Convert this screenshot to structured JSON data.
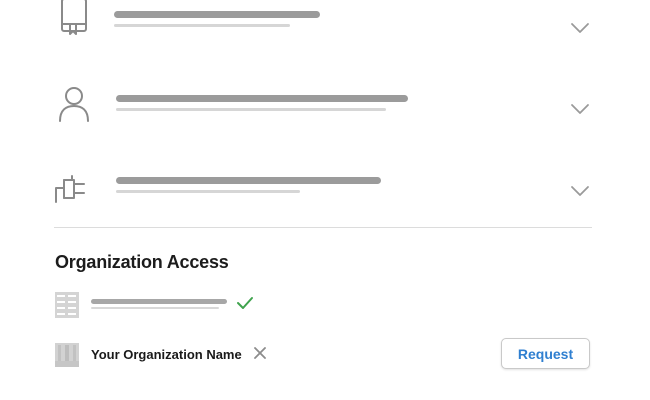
{
  "rows": [
    {
      "icon": "book-icon"
    },
    {
      "icon": "user-icon"
    },
    {
      "icon": "plug-icon"
    }
  ],
  "organization_access": {
    "title": "Organization Access",
    "organizations": [
      {
        "icon": "organization-building-icon",
        "status": "check-icon"
      },
      {
        "icon": "organization-building-icon",
        "name": "Your Organization Name",
        "status": "x-icon",
        "action_label": "Request"
      }
    ]
  },
  "colors": {
    "accent": "#2f7fd0",
    "check": "#3fa34d",
    "placeholder": "#9b9b9b",
    "divider": "#dcdcdc"
  }
}
